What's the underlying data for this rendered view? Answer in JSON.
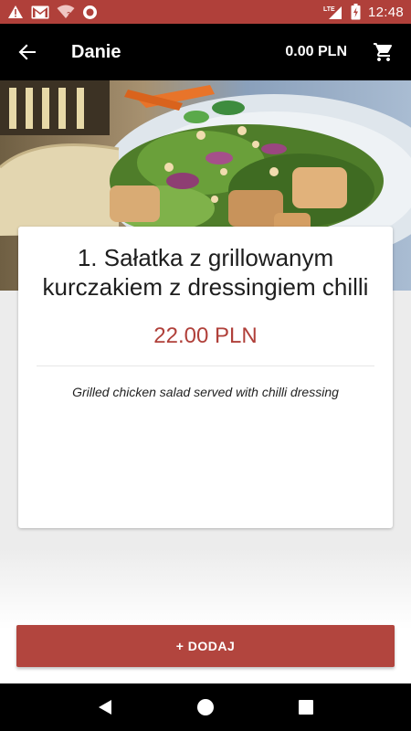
{
  "status_bar": {
    "time": "12:48",
    "network_label": "LTE",
    "icons": [
      "warning-icon",
      "gmail-icon",
      "wifi-icon",
      "record-icon",
      "signal-icon",
      "battery-charging-icon"
    ]
  },
  "app_bar": {
    "title": "Danie",
    "cart_total": "0.00 PLN",
    "icons": [
      "back-arrow-icon",
      "shopping-cart-icon"
    ]
  },
  "dish": {
    "name": "1. Sałatka z grillowanym kurczakiem z dressingiem chilli",
    "price": "22.00 PLN",
    "description": "Grilled chicken salad served with chilli dressing"
  },
  "actions": {
    "add_label": "+ DODAJ"
  },
  "nav_bar": {
    "icons": [
      "back-triangle-icon",
      "home-circle-icon",
      "recents-square-icon"
    ]
  },
  "colors": {
    "accent": "#b0403a",
    "app_bar": "#000000",
    "price": "#b0403a"
  }
}
